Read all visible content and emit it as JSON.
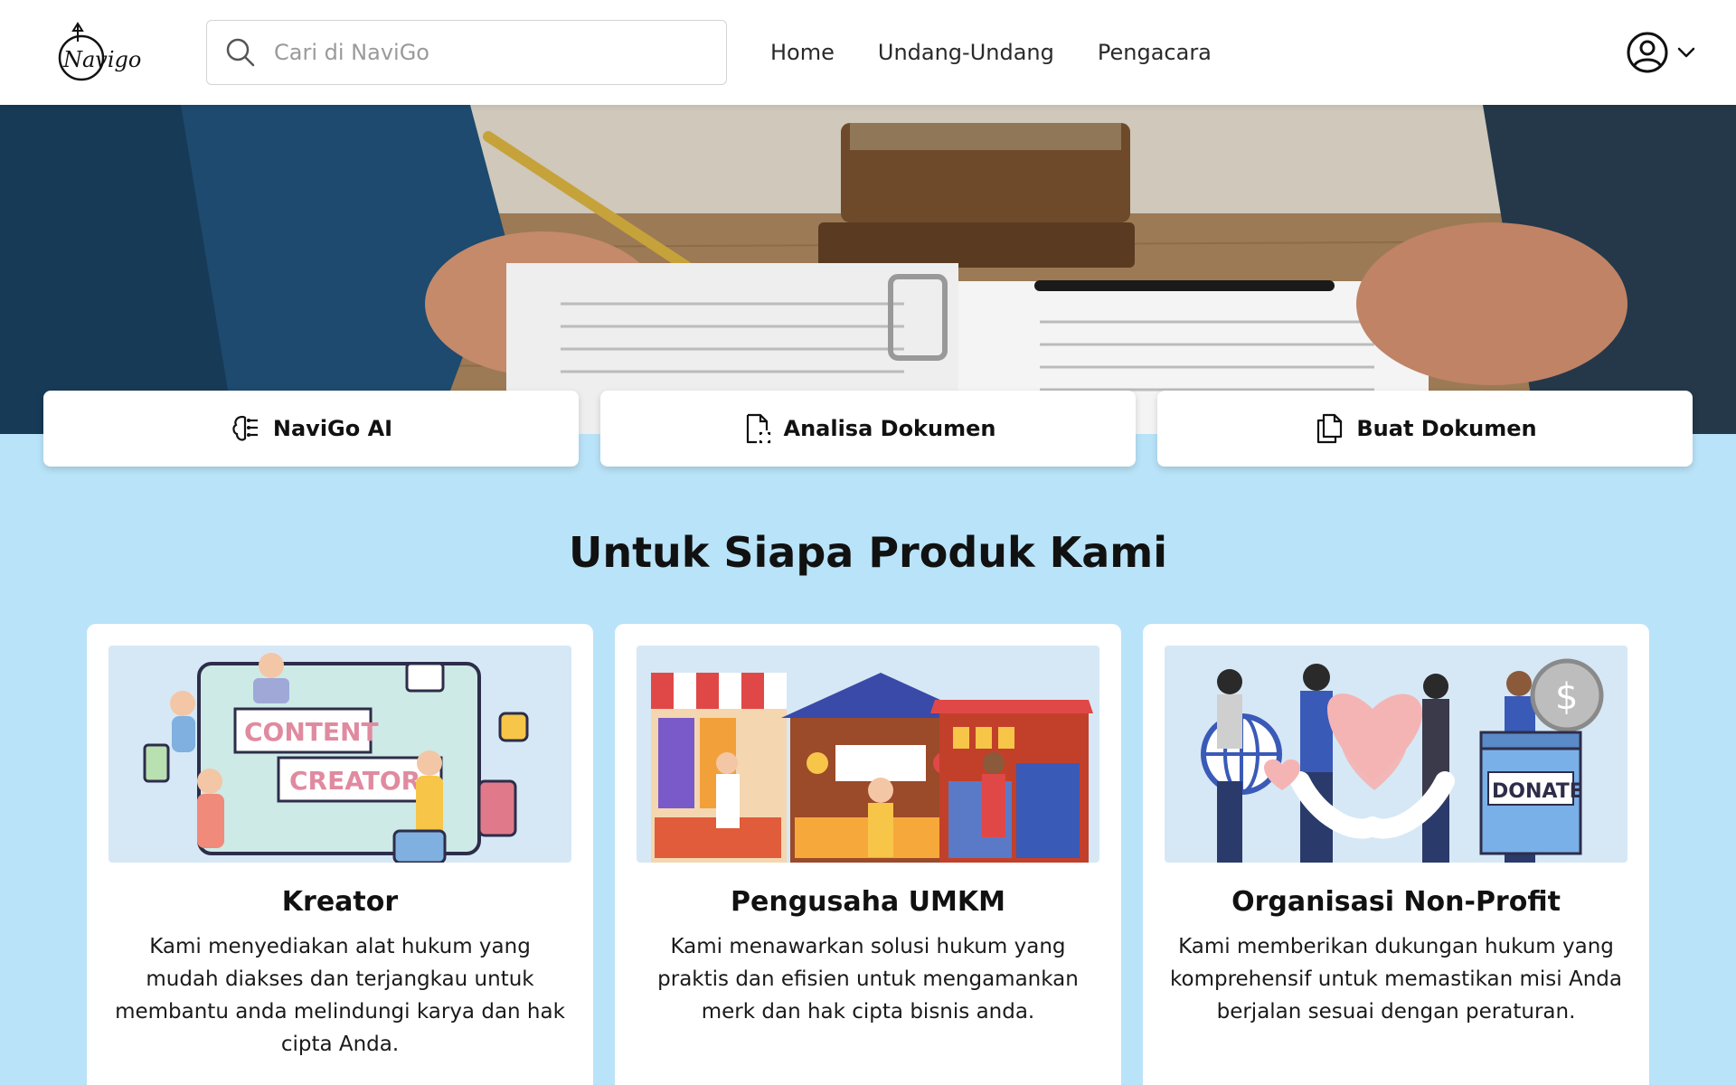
{
  "header": {
    "logo_text": "Navigo",
    "search": {
      "placeholder": "Cari di NaviGo",
      "value": ""
    },
    "nav": [
      {
        "label": "Home"
      },
      {
        "label": "Undang-Undang"
      },
      {
        "label": "Pengacara"
      }
    ],
    "user_menu_icon": "user-circle-icon"
  },
  "actions": [
    {
      "label": "NaviGo AI",
      "icon": "brain-ai-icon"
    },
    {
      "label": "Analisa Dokumen",
      "icon": "document-scan-icon"
    },
    {
      "label": "Buat Dokumen",
      "icon": "documents-copy-icon"
    }
  ],
  "section": {
    "title": "Untuk Siapa Produk Kami",
    "products": [
      {
        "title": "Kreator",
        "description": "Kami menyediakan alat hukum yang mudah diakses dan terjangkau untuk membantu anda melindungi karya dan hak cipta Anda.",
        "image_labels": [
          "CONTENT",
          "CREATOR"
        ]
      },
      {
        "title": "Pengusaha UMKM",
        "description": "Kami menawarkan solusi hukum yang praktis dan efisien untuk mengamankan merk dan hak cipta bisnis anda."
      },
      {
        "title": "Organisasi Non-Profit",
        "description": "Kami memberikan dukungan hukum yang komprehensif untuk memastikan misi Anda berjalan sesuai dengan peraturan.",
        "image_labels": [
          "DONATE"
        ]
      }
    ]
  },
  "colors": {
    "background": "#b9e3f8",
    "card": "#ffffff",
    "text": "#111111"
  }
}
